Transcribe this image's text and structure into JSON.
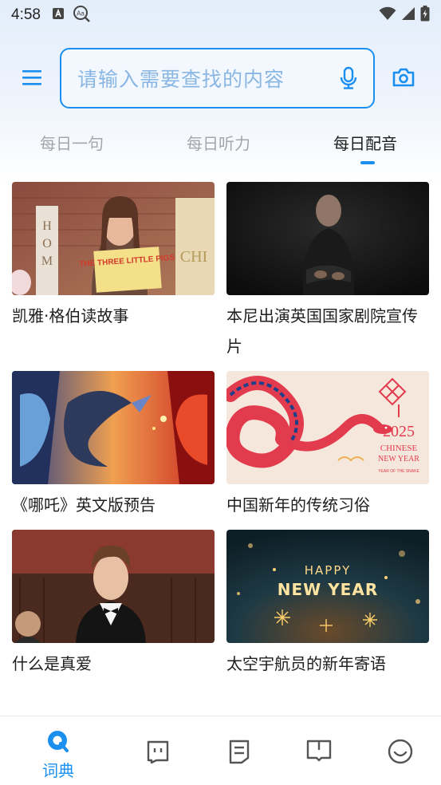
{
  "status_bar": {
    "time": "4:58",
    "icons": [
      "font-a-icon",
      "text-scan-icon",
      "wifi-icon",
      "cell-signal-icon",
      "battery-icon"
    ]
  },
  "search": {
    "placeholder": "请输入需要查找的内容"
  },
  "tabs": [
    {
      "label": "每日一句",
      "active": false
    },
    {
      "label": "每日听力",
      "active": false
    },
    {
      "label": "每日配音",
      "active": true
    }
  ],
  "cards": [
    {
      "title": "凯雅·格伯读故事",
      "image": "woman holding a picture book"
    },
    {
      "title": "本尼出演英国国家剧院宣传片",
      "image": "man seated on dark stage"
    },
    {
      "title": "《哪吒》英文版预告",
      "image": "animated dragon and characters"
    },
    {
      "title": "中国新年的传统习俗",
      "image": "snake illustration"
    },
    {
      "title": "什么是真爱",
      "image": "young man in bow tie speaking"
    },
    {
      "title": "太空宇航员的新年寄语",
      "image": "sparklers and lettering"
    }
  ],
  "card_image_text": {
    "book_title": "THE THREE LITTLE PIGS",
    "snake_year": "2025",
    "snake_line1": "CHINESE",
    "snake_line2": "NEW YEAR",
    "snake_line3": "YEAR OF THE SNAKE",
    "happy": "HAPPY",
    "new_year": "NEW YEAR"
  },
  "bottom_nav": [
    {
      "label": "词典",
      "icon": "search-icon",
      "active": true
    },
    {
      "label": "",
      "icon": "chat-face-icon",
      "active": false
    },
    {
      "label": "",
      "icon": "document-icon",
      "active": false
    },
    {
      "label": "",
      "icon": "book-icon",
      "active": false
    },
    {
      "label": "",
      "icon": "smile-icon",
      "active": false
    }
  ],
  "colors": {
    "accent": "#1a8ff0",
    "tab_inactive": "#a3a7ad",
    "text": "#1e1e1e"
  }
}
